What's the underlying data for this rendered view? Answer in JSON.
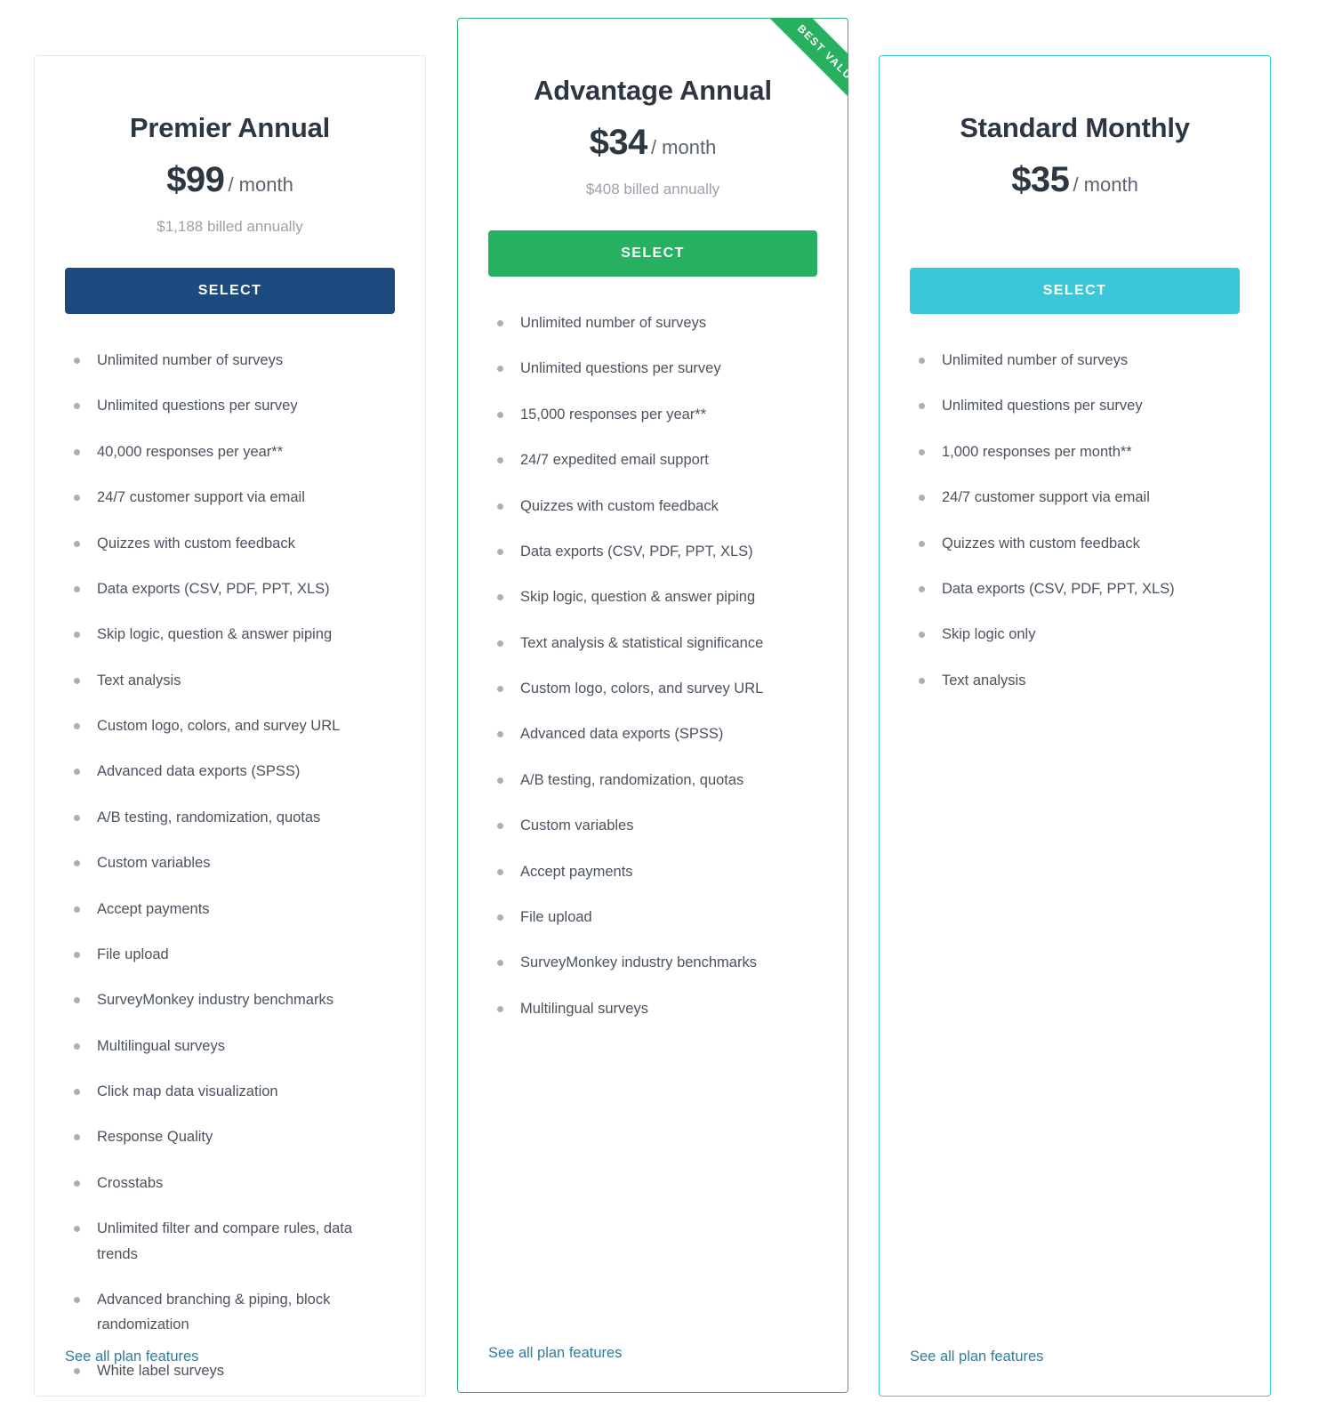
{
  "plans": [
    {
      "id": "premier-annual",
      "name": "Premier Annual",
      "price": "$99",
      "period": "/ month",
      "billed": "$1,188 billed annually",
      "select_label": "SELECT",
      "accent": "#1b4a7e",
      "border": "#e7e9ea",
      "see_all_label": "See all plan features",
      "features": [
        "Unlimited number of surveys",
        "Unlimited questions per survey",
        "40,000 responses per year**",
        "24/7 customer support via email",
        "Quizzes with custom feedback",
        "Data exports (CSV, PDF, PPT, XLS)",
        "Skip logic, question & answer piping",
        "Text analysis",
        "Custom logo, colors, and survey URL",
        "Advanced data exports (SPSS)",
        "A/B testing, randomization, quotas",
        "Custom variables",
        "Accept payments",
        "File upload",
        "SurveyMonkey industry benchmarks",
        "Multilingual surveys",
        "Click map data visualization",
        "Response Quality",
        "Crosstabs",
        "Unlimited filter and compare rules, data trends",
        "Advanced branching & piping, block randomization",
        "White label surveys"
      ]
    },
    {
      "id": "advantage-annual",
      "name": "Advantage Annual",
      "price": "$34",
      "period": "/ month",
      "billed": "$408 billed annually",
      "select_label": "SELECT",
      "accent": "#27b05f",
      "border": "#2ab573",
      "ribbon_label": "BEST VALUE",
      "see_all_label": "See all plan features",
      "features": [
        "Unlimited number of surveys",
        "Unlimited questions per survey",
        "15,000 responses per year**",
        "24/7 expedited email support",
        "Quizzes with custom feedback",
        "Data exports (CSV, PDF, PPT, XLS)",
        "Skip logic, question & answer piping",
        "Text analysis & statistical significance",
        "Custom logo, colors, and survey URL",
        "Advanced data exports (SPSS)",
        "A/B testing, randomization, quotas",
        "Custom variables",
        "Accept payments",
        "File upload",
        "SurveyMonkey industry benchmarks",
        "Multilingual surveys"
      ]
    },
    {
      "id": "standard-monthly",
      "name": "Standard Monthly",
      "price": "$35",
      "period": "/ month",
      "billed": "",
      "select_label": "SELECT",
      "accent": "#3ac8d8",
      "border": "#3ac8d8",
      "see_all_label": "See all plan features",
      "features": [
        "Unlimited number of surveys",
        "Unlimited questions per survey",
        "1,000 responses per month**",
        "24/7 customer support via email",
        "Quizzes with custom feedback",
        "Data exports (CSV, PDF, PPT, XLS)",
        "Skip logic only",
        "Text analysis"
      ]
    }
  ]
}
